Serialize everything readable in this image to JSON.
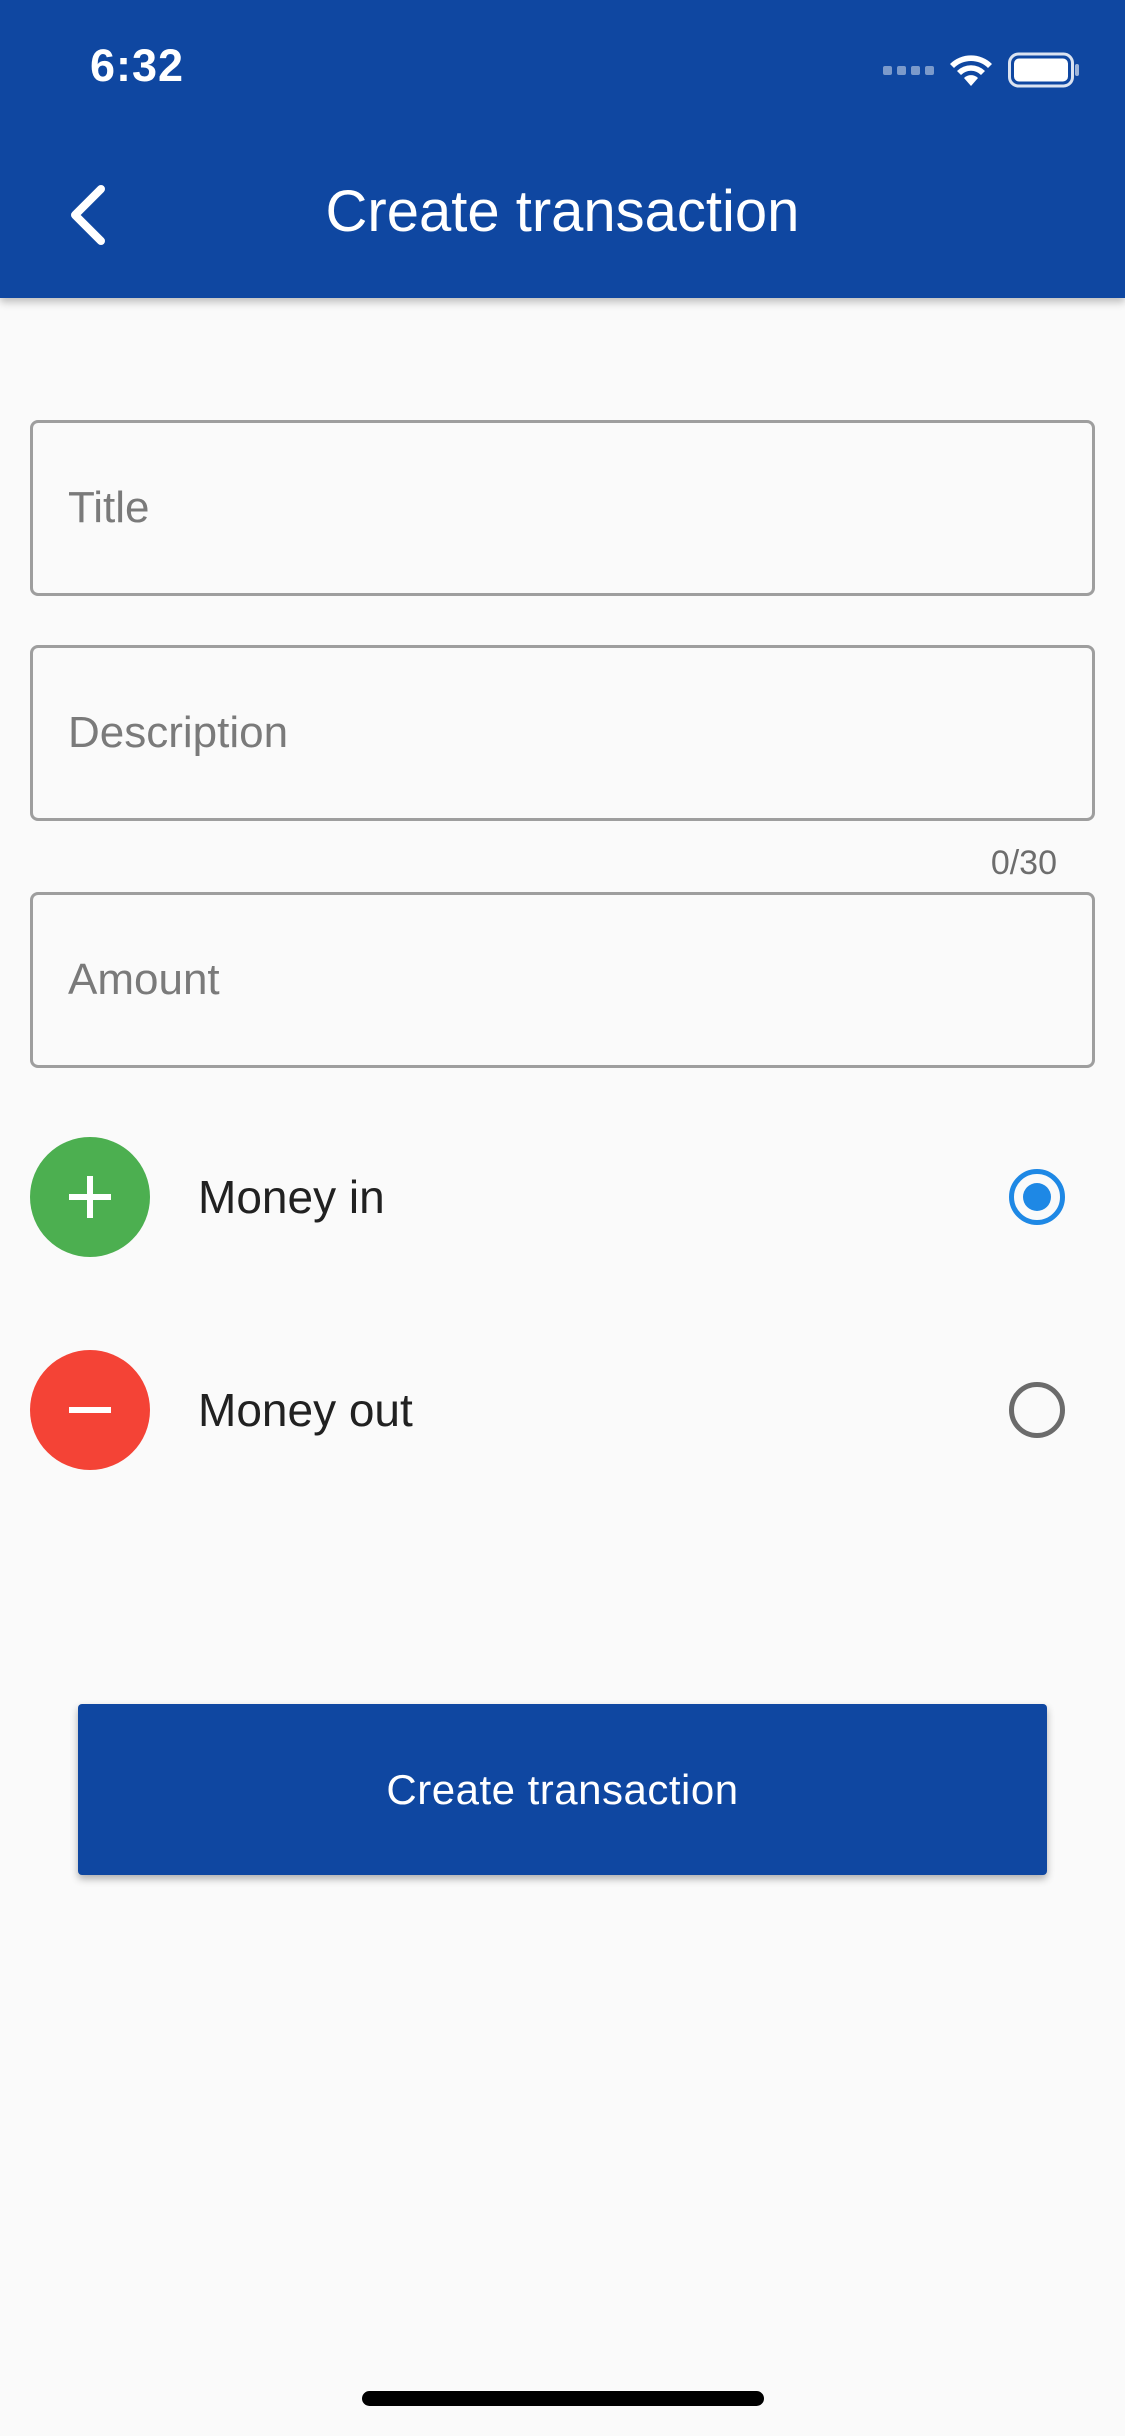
{
  "status_bar": {
    "time": "6:32",
    "icons": [
      "cellular-signal-icon",
      "wifi-icon",
      "battery-icon"
    ]
  },
  "app_bar": {
    "title": "Create transaction",
    "back_icon": "chevron-left-icon"
  },
  "form": {
    "title_field": {
      "placeholder": "Title",
      "value": ""
    },
    "description_field": {
      "placeholder": "Description",
      "value": "",
      "counter": "0/30"
    },
    "amount_field": {
      "placeholder": "Amount",
      "value": ""
    }
  },
  "transaction_type": {
    "options": [
      {
        "label": "Money in",
        "icon": "plus-icon",
        "color": "#4caf50",
        "selected": true
      },
      {
        "label": "Money out",
        "icon": "minus-icon",
        "color": "#f44336",
        "selected": false
      }
    ]
  },
  "submit": {
    "label": "Create transaction"
  },
  "colors": {
    "primary": "#0f47a1",
    "radio_selected": "#1e88e5",
    "background": "#fafafa"
  }
}
